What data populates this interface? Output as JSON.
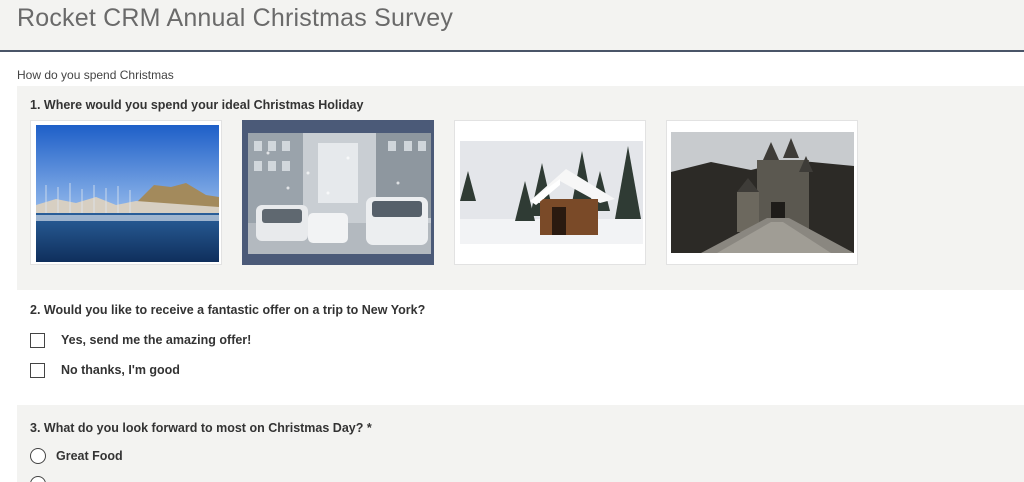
{
  "header": {
    "title": "Rocket CRM Annual Christmas Survey"
  },
  "section": {
    "label": "How do you spend Christmas"
  },
  "q1": {
    "title": "1. Where would you spend your ideal Christmas Holiday",
    "options": [
      {
        "name": "sunny-harbor-image",
        "selected": false
      },
      {
        "name": "snowy-city-street-image",
        "selected": true
      },
      {
        "name": "snowy-cabin-image",
        "selected": false
      },
      {
        "name": "castle-image",
        "selected": false
      }
    ]
  },
  "q2": {
    "title": "2. Would you like to receive a fantastic offer on a trip to New York?",
    "options": [
      {
        "label": "Yes, send me the amazing offer!",
        "checked": false
      },
      {
        "label": "No thanks, I'm good",
        "checked": false
      }
    ]
  },
  "q3": {
    "title": "3. What do you look forward to most on Christmas Day? *",
    "options": [
      {
        "label": "Great Food",
        "selected": false
      }
    ]
  },
  "colors": {
    "selected_card": "#4b5a78",
    "panel_bg": "#f3f3f1",
    "header_rule": "#4a5568"
  }
}
